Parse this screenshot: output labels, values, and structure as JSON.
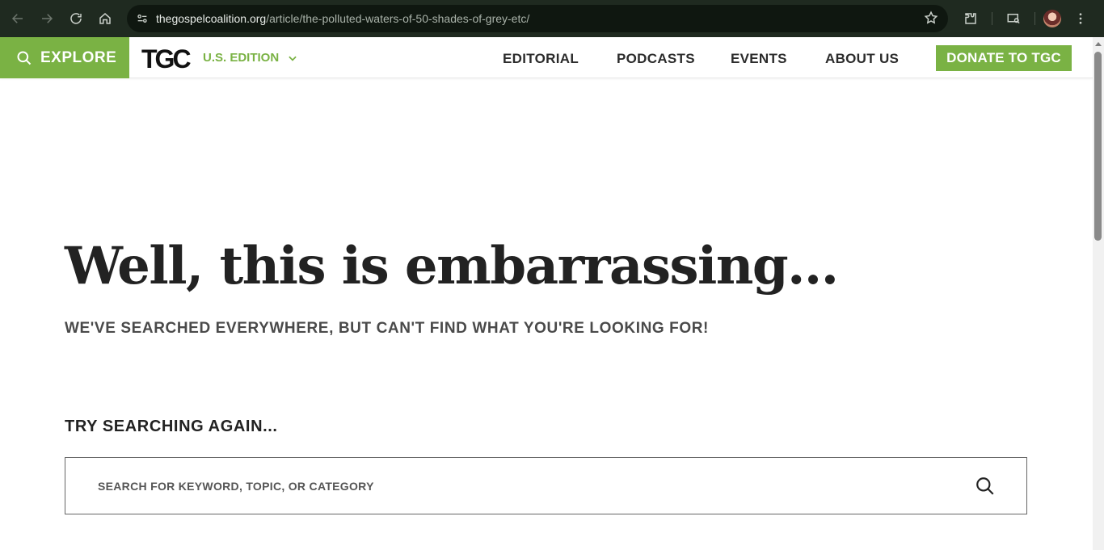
{
  "browser": {
    "url_host": "thegospelcoalition.org",
    "url_path": "/article/the-polluted-waters-of-50-shades-of-grey-etc/"
  },
  "header": {
    "explore_label": "EXPLORE",
    "logo_text": "TGC",
    "edition_label": "U.S. EDITION",
    "nav": [
      "EDITORIAL",
      "PODCASTS",
      "EVENTS",
      "ABOUT US"
    ],
    "donate_label": "DONATE TO TGC"
  },
  "main": {
    "headline": "Well, this is embarrassing...",
    "subhead": "WE'VE SEARCHED EVERYWHERE, BUT CAN'T FIND WHAT YOU'RE LOOKING FOR!",
    "try_label": "TRY SEARCHING AGAIN...",
    "search_placeholder": "SEARCH FOR KEYWORD, TOPIC, OR CATEGORY"
  },
  "colors": {
    "brand_green": "#7ab244",
    "chrome_bg": "#1f2a20"
  }
}
